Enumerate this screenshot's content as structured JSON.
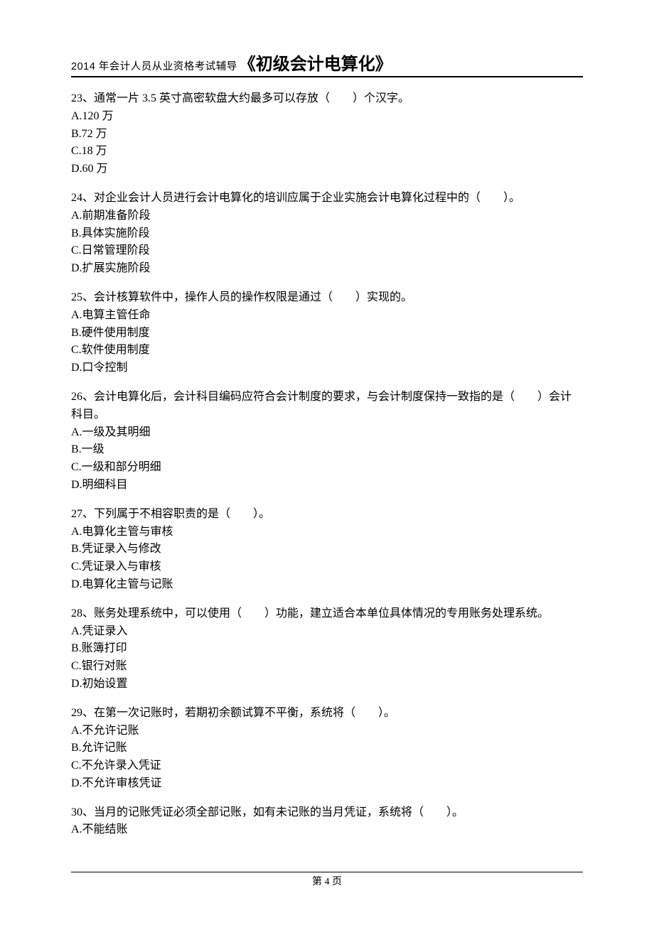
{
  "header": {
    "small": "2014 年会计人员从业资格考试辅导",
    "big": "《初级会计电算化》"
  },
  "questions": [
    {
      "num": "23、",
      "stem": "通常一片 3.5 英寸高密软盘大约最多可以存放（　　）个汉字。",
      "options": [
        "A.120 万",
        "B.72 万",
        "C.18 万",
        "D.60 万"
      ]
    },
    {
      "num": "24、",
      "stem": "对企业会计人员进行会计电算化的培训应属于企业实施会计电算化过程中的（　　）。",
      "options": [
        "A.前期准备阶段",
        "B.具体实施阶段",
        "C.日常管理阶段",
        "D.扩展实施阶段"
      ]
    },
    {
      "num": "25、",
      "stem": "会计核算软件中，操作人员的操作权限是通过（　　）实现的。",
      "options": [
        "A.电算主管任命",
        "B.硬件使用制度",
        "C.软件使用制度",
        "D.口令控制"
      ]
    },
    {
      "num": "26、",
      "stem": "会计电算化后，会计科目编码应符合会计制度的要求，与会计制度保持一致指的是（　　）会计科目。",
      "options": [
        "A.一级及其明细",
        "B.一级",
        "C.一级和部分明细",
        "D.明细科目"
      ]
    },
    {
      "num": "27、",
      "stem": "下列属于不相容职责的是（　　）。",
      "options": [
        "A.电算化主管与审核",
        "B.凭证录入与修改",
        "C.凭证录入与审核",
        "D.电算化主管与记账"
      ]
    },
    {
      "num": "28、",
      "stem": "账务处理系统中，可以使用（　　）功能，建立适合本单位具体情况的专用账务处理系统。",
      "options": [
        "A.凭证录入",
        "B.账簿打印",
        "C.银行对账",
        "D.初始设置"
      ]
    },
    {
      "num": "29、",
      "stem": "在第一次记账时，若期初余额试算不平衡，系统将（　　）。",
      "options": [
        "A.不允许记账",
        "B.允许记账",
        "C.不允许录入凭证",
        "D.不允许审核凭证"
      ]
    },
    {
      "num": "30、",
      "stem": "当月的记账凭证必须全部记账，如有未记账的当月凭证，系统将（　　）。",
      "options": [
        "A.不能结账"
      ]
    }
  ],
  "footer": {
    "page_label": "第 4 页"
  }
}
